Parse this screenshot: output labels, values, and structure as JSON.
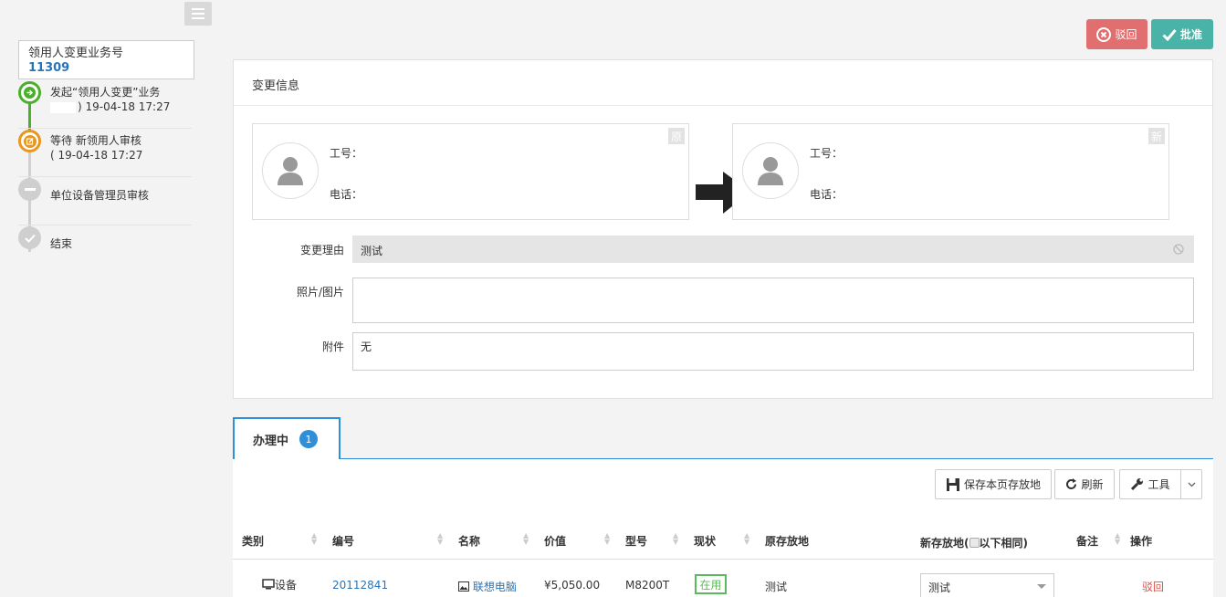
{
  "sidebar": {
    "business_label": "领用人变更业务号",
    "business_number": "11309",
    "steps": [
      {
        "title": "发起“领用人变更”业务",
        "time": ") 19-04-18 17:27",
        "status": "done"
      },
      {
        "title": "等待 新领用人审核",
        "time": "( 19-04-18 17:27",
        "status": "current"
      },
      {
        "title": "单位设备管理员审核",
        "time": "",
        "status": "pending"
      },
      {
        "title": "结束",
        "time": "",
        "status": "end"
      }
    ]
  },
  "actions": {
    "reject_label": "驳回",
    "approve_label": "批准"
  },
  "change_info": {
    "title": "变更信息",
    "original": {
      "tag": "原",
      "id_label": "工号：",
      "phone_label": "电话："
    },
    "new": {
      "tag": "新",
      "id_label": "工号：",
      "phone_label": "电话："
    },
    "reason_label": "变更理由",
    "reason_value": "测试",
    "photo_label": "照片/图片",
    "attachment_label": "附件",
    "attachment_value": "无"
  },
  "tabs": [
    {
      "label": "办理中",
      "count": "1"
    }
  ],
  "toolbar": {
    "save_location": "保存本页存放地",
    "refresh": "刷新",
    "tools": "工具"
  },
  "table": {
    "headers": {
      "category": "类别",
      "number": "编号",
      "name": "名称",
      "value": "价值",
      "model": "型号",
      "status": "现状",
      "orig_location": "原存放地",
      "new_location": "新存放地(",
      "same_below": "以下相同)",
      "remark": "备注",
      "operation": "操作"
    },
    "rows": [
      {
        "category": "设备",
        "number": "20112841",
        "name": "联想电脑",
        "value": "¥5,050.00",
        "model": "M8200T",
        "status": "在用",
        "orig_location": "测试",
        "new_location": "测试",
        "remark": "",
        "operation": "驳回"
      }
    ]
  },
  "colors": {
    "accent": "#2f8fd8",
    "approve": "#48b3a6",
    "reject": "#e16f6f",
    "success": "#5cb85c"
  }
}
